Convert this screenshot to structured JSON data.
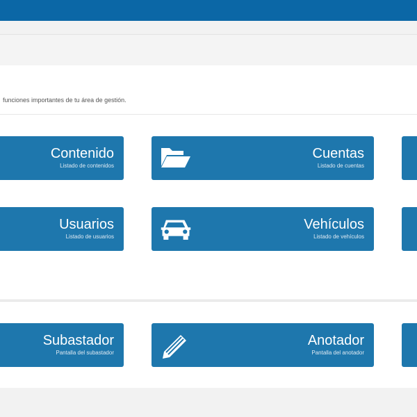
{
  "intro": {
    "text": "funciones importantes de tu área de gestión."
  },
  "tiles": {
    "contenido": {
      "title": "Contenido",
      "subtitle": "Listado de contenidos"
    },
    "cuentas": {
      "title": "Cuentas",
      "subtitle": "Listado de cuentas",
      "icon": "folder-open-icon"
    },
    "usuarios": {
      "title": "Usuarios",
      "subtitle": "Listado de usuarios"
    },
    "vehiculos": {
      "title": "Vehículos",
      "subtitle": "Listado de vehículos",
      "icon": "car-icon"
    },
    "subastador": {
      "title": "Subastador",
      "subtitle": "Pantalla del subastador"
    },
    "anotador": {
      "title": "Anotador",
      "subtitle": "Pantalla del anotador",
      "icon": "pencil-icon"
    }
  },
  "partial_icons": [
    "tag-icon",
    "document-icon",
    "monitor-icon"
  ],
  "colors": {
    "header": "#0b67a6",
    "tile": "#1e77ad",
    "background": "#f2f2f2"
  }
}
